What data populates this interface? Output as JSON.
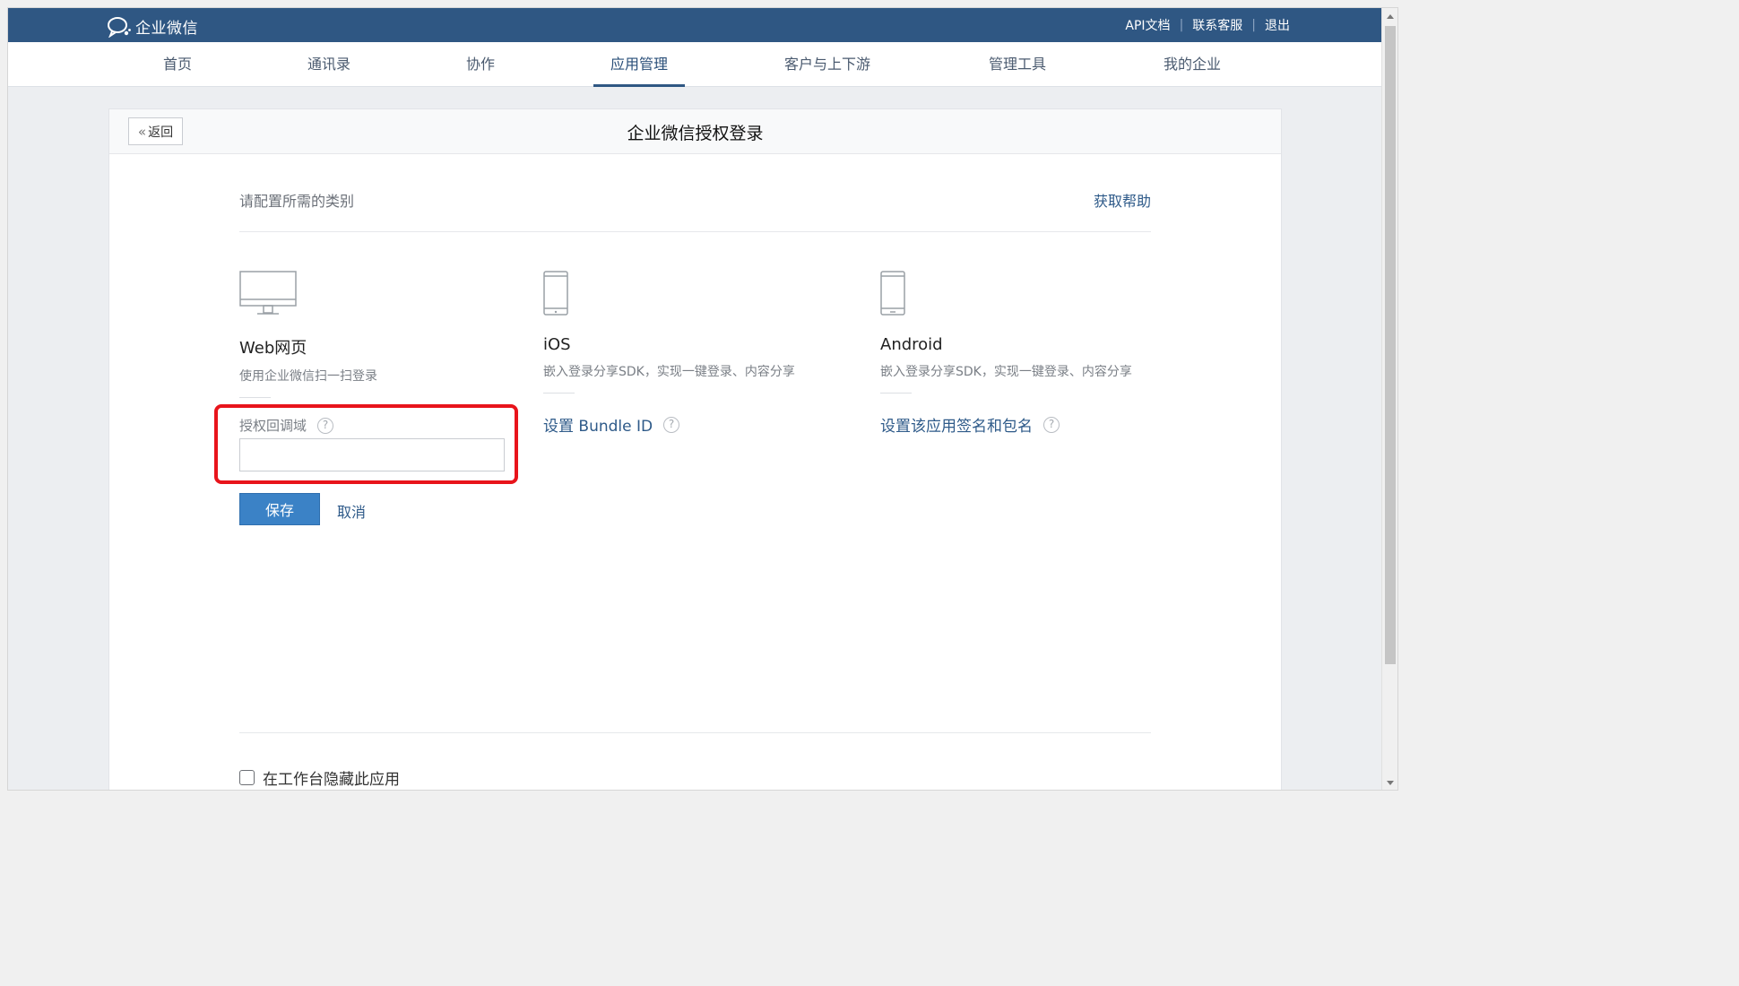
{
  "topbar": {
    "logo_text": "企业微信",
    "links": [
      "API文档",
      "联系客服",
      "退出"
    ],
    "separator": "|"
  },
  "nav": {
    "items": [
      "首页",
      "通讯录",
      "协作",
      "应用管理",
      "客户与上下游",
      "管理工具",
      "我的企业"
    ],
    "active": "应用管理"
  },
  "card": {
    "back_label": "返回",
    "back_icon": "«",
    "title": "企业微信授权登录",
    "section_label": "请配置所需的类别",
    "help_link": "获取帮助",
    "platforms": [
      {
        "name": "Web网页",
        "desc": "使用企业微信扫一扫登录",
        "icon": "monitor-icon"
      },
      {
        "name": "iOS",
        "desc": "嵌入登录分享SDK，实现一键登录、内容分享",
        "icon": "phone-icon",
        "config": "设置 Bundle ID"
      },
      {
        "name": "Android",
        "desc": "嵌入登录分享SDK，实现一键登录、内容分享",
        "icon": "phone-icon",
        "config": "设置该应用签名和包名"
      }
    ],
    "callback": {
      "label": "授权回调域",
      "value": "",
      "placeholder": ""
    },
    "help_glyph": "?",
    "save_label": "保存",
    "cancel_label": "取消",
    "hide_app_label": "在工作台隐藏此应用",
    "hide_app_checked": false
  },
  "colors": {
    "topbar": "#2f5783",
    "primary_button": "#3b82c6",
    "link": "#2e5a89",
    "highlight": "#e8141b"
  }
}
